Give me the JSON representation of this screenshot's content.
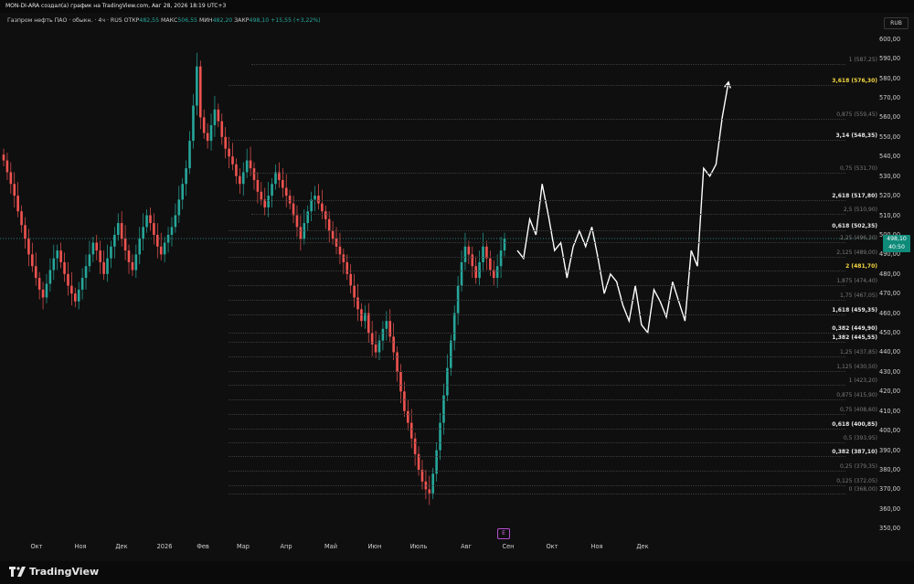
{
  "header": {
    "text": "MON-DI-ARA создал(а) график на TradingView.com, Авг 28, 2026 18:19 UTC+3"
  },
  "legend": {
    "symbol": "Газпром нефть ПАО · обыкн. · 4ч · RUS",
    "open_label": "ОТКР",
    "open": "482,55",
    "high_label": "МАКС",
    "high": "506,55",
    "low_label": "МИН",
    "low": "482,20",
    "close_label": "ЗАКР",
    "close": "498,10",
    "change": "+15,55 (+3,22%)"
  },
  "axis": {
    "currency": "RUB",
    "price_tag_price": "498,10",
    "price_tag_time": "40:50",
    "y_ticks": [
      "600,00",
      "590,00",
      "580,00",
      "570,00",
      "560,00",
      "550,00",
      "540,00",
      "530,00",
      "520,00",
      "510,00",
      "500,00",
      "490,00",
      "480,00",
      "470,00",
      "460,00",
      "450,00",
      "440,00",
      "430,00",
      "420,00",
      "410,00",
      "400,00",
      "390,00",
      "380,00",
      "370,00",
      "360,00",
      "350,00"
    ],
    "x_ticks": [
      "Окт",
      "Ноя",
      "Дек",
      "2026",
      "Фев",
      "Мар",
      "Апр",
      "Май",
      "Июн",
      "Июль",
      "Авг",
      "Сен",
      "Окт",
      "Ноя",
      "Дек"
    ]
  },
  "events_badge": "E",
  "footer": {
    "brand": "TradingView"
  },
  "colors": {
    "up": "#26a69a",
    "down": "#ef5350",
    "highlight": "#f5d742",
    "projection": "#ffffff"
  },
  "fib_levels": [
    {
      "label": "1 (587,25)",
      "price": 587.25,
      "style": "dim"
    },
    {
      "label": "3,618 (576,30)",
      "price": 576.3,
      "style": "yellow"
    },
    {
      "label": "0,875 (559,45)",
      "price": 559.45,
      "style": "dim"
    },
    {
      "label": "3,14 (548,35)",
      "price": 548.35,
      "style": "bright"
    },
    {
      "label": "0,75 (531,70)",
      "price": 531.7,
      "style": "dim"
    },
    {
      "label": "2,618 (517,80)",
      "price": 517.8,
      "style": "bright"
    },
    {
      "label": "2,5 (510,90)",
      "price": 510.9,
      "style": "dim"
    },
    {
      "label": "0,618 (502,35)",
      "price": 502.35,
      "style": "bright"
    },
    {
      "label": "2,25 (496,30)",
      "price": 496.3,
      "style": "dim"
    },
    {
      "label": "2,125 (489,00)",
      "price": 489.0,
      "style": "dim"
    },
    {
      "label": "2 (481,70)",
      "price": 481.7,
      "style": "yellow"
    },
    {
      "label": "1,875 (474,40)",
      "price": 474.4,
      "style": "dim"
    },
    {
      "label": "1,75 (467,05)",
      "price": 467.05,
      "style": "dim"
    },
    {
      "label": "1,618 (459,35)",
      "price": 459.35,
      "style": "bright"
    },
    {
      "label": "0,382 (449,90)",
      "price": 449.9,
      "style": "bright"
    },
    {
      "label": "1,382 (445,55)",
      "price": 445.55,
      "style": "bright"
    },
    {
      "label": "1,25 (437,85)",
      "price": 437.85,
      "style": "dim"
    },
    {
      "label": "1,125 (430,50)",
      "price": 430.5,
      "style": "dim"
    },
    {
      "label": "1 (423,20)",
      "price": 423.2,
      "style": "dim"
    },
    {
      "label": "0,875 (415,90)",
      "price": 415.9,
      "style": "dim"
    },
    {
      "label": "0,75 (408,60)",
      "price": 408.6,
      "style": "dim"
    },
    {
      "label": "0,618 (400,85)",
      "price": 400.85,
      "style": "bright"
    },
    {
      "label": "0,5 (393,95)",
      "price": 393.95,
      "style": "dim"
    },
    {
      "label": "0,382 (387,10)",
      "price": 387.1,
      "style": "bright"
    },
    {
      "label": "0,25 (379,35)",
      "price": 379.35,
      "style": "dim"
    },
    {
      "label": "0,125 (372,05)",
      "price": 372.05,
      "style": "dim"
    },
    {
      "label": "0 (368,00)",
      "price": 368.0,
      "style": "dim"
    }
  ],
  "chart_data": {
    "type": "line",
    "y_range": [
      345,
      605
    ],
    "price_series_closes": [
      538,
      532,
      526,
      520,
      512,
      505,
      498,
      490,
      484,
      478,
      472,
      468,
      475,
      482,
      488,
      492,
      486,
      480,
      474,
      470,
      466,
      472,
      478,
      484,
      490,
      496,
      492,
      486,
      480,
      488,
      494,
      500,
      506,
      498,
      492,
      486,
      482,
      490,
      498,
      504,
      510,
      506,
      500,
      494,
      490,
      496,
      500,
      504,
      510,
      518,
      526,
      534,
      548,
      566,
      586,
      560,
      552,
      548,
      556,
      564,
      558,
      550,
      544,
      540,
      536,
      530,
      526,
      532,
      538,
      534,
      528,
      522,
      518,
      514,
      520,
      526,
      532,
      528,
      524,
      520,
      516,
      510,
      504,
      498,
      506,
      512,
      518,
      520,
      516,
      512,
      508,
      502,
      498,
      494,
      490,
      486,
      480,
      474,
      468,
      462,
      456,
      460,
      450,
      444,
      440,
      446,
      452,
      456,
      448,
      440,
      430,
      420,
      410,
      404,
      396,
      388,
      380,
      374,
      370,
      368,
      378,
      390,
      404,
      418,
      432,
      446,
      460,
      474,
      486,
      494,
      490,
      484,
      478,
      486,
      494,
      488,
      482,
      478,
      484,
      492,
      498
    ],
    "projection_path": [
      [
        0,
        492
      ],
      [
        1,
        488
      ],
      [
        2,
        508
      ],
      [
        3,
        500
      ],
      [
        4,
        526
      ],
      [
        5,
        510
      ],
      [
        6,
        492
      ],
      [
        7,
        496
      ],
      [
        8,
        478
      ],
      [
        9,
        494
      ],
      [
        10,
        502
      ],
      [
        11,
        494
      ],
      [
        12,
        504
      ],
      [
        13,
        488
      ],
      [
        14,
        470
      ],
      [
        15,
        480
      ],
      [
        16,
        476
      ],
      [
        17,
        464
      ],
      [
        18,
        456
      ],
      [
        19,
        474
      ],
      [
        20,
        454
      ],
      [
        21,
        450
      ],
      [
        22,
        472
      ],
      [
        23,
        466
      ],
      [
        24,
        458
      ],
      [
        25,
        476
      ],
      [
        26,
        466
      ],
      [
        27,
        456
      ],
      [
        28,
        492
      ],
      [
        29,
        484
      ],
      [
        30,
        534
      ],
      [
        31,
        530
      ],
      [
        32,
        536
      ],
      [
        33,
        560
      ],
      [
        34,
        578
      ]
    ],
    "last_price": 498.1
  }
}
